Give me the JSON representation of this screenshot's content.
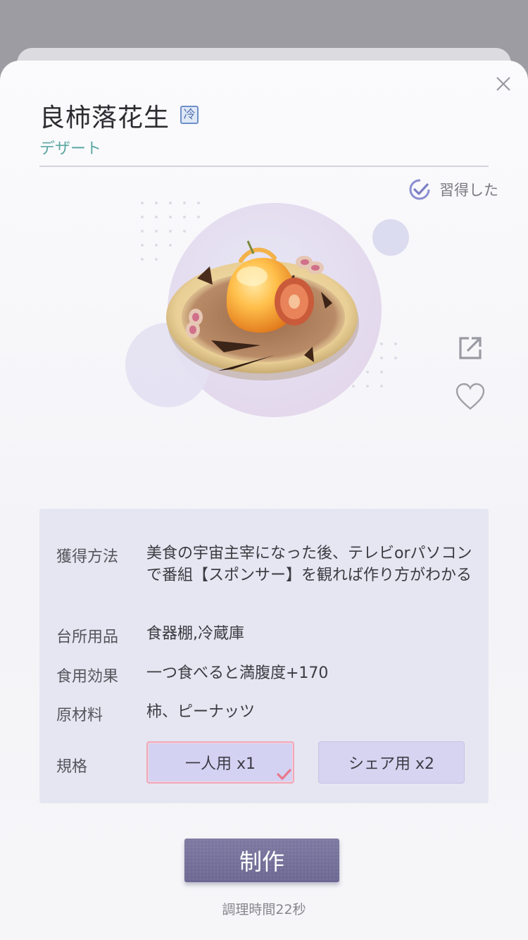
{
  "dialog": {
    "title": "良柿落花生",
    "storage_tag": "冷",
    "category": "デザート",
    "learned_label": "習得した",
    "close_icon": "close-icon",
    "share_icon": "share-icon",
    "favorite_icon": "heart-icon"
  },
  "info": {
    "rows": [
      {
        "label": "獲得方法",
        "value": "美食の宇宙主宰になった後、テレビorパソコンで番組【スポンサー】を観れば作り方がわかる"
      },
      {
        "label": "台所用品",
        "value": "食器棚,冷蔵庫"
      },
      {
        "label": "食用効果",
        "value": "一つ食べると満腹度+170"
      },
      {
        "label": "原材料",
        "value": "柿、ピーナッツ"
      },
      {
        "label": "規格",
        "value": ""
      }
    ],
    "spec_options": [
      {
        "label": "一人用 x1",
        "selected": true
      },
      {
        "label": "シェア用 x2",
        "selected": false
      }
    ]
  },
  "actions": {
    "make_label": "制作",
    "cook_time": "調理時間22秒"
  },
  "colors": {
    "accent_teal": "#5aa7a0",
    "button_purple": "#74709a",
    "panel_bg": "#e6e6f2",
    "selected_border": "#f0a8b8"
  }
}
